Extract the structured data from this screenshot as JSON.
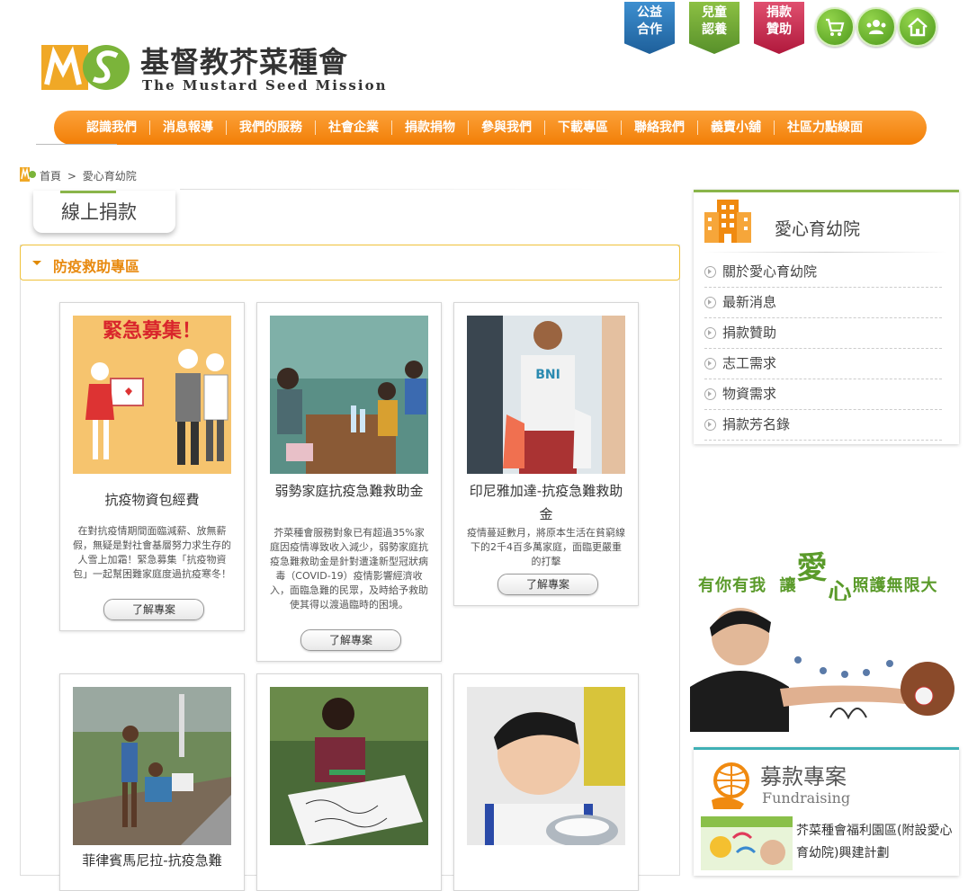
{
  "header": {
    "logo_title_cn": "基督教芥菜種會",
    "logo_title_en": "The Mustard Seed Mission",
    "ribbons": [
      {
        "line1": "公益",
        "line2": "合作",
        "color": "#2a74b5"
      },
      {
        "line1": "兒童",
        "line2": "認養",
        "color": "#6ea33a"
      },
      {
        "line1": "捐款",
        "line2": "贊助",
        "color": "#c9234b"
      }
    ],
    "icon_buttons": [
      "cart-icon",
      "members-icon",
      "home-icon"
    ]
  },
  "nav": {
    "items": [
      "認識我們",
      "消息報導",
      "我們的服務",
      "社會企業",
      "捐款捐物",
      "參與我們",
      "下載專區",
      "聯絡我們",
      "義賣小舖",
      "社區力點線面"
    ],
    "color": "#f5870f"
  },
  "breadcrumb": {
    "home": "首頁",
    "separator": ">",
    "current": "愛心育幼院"
  },
  "main": {
    "tab_label": "線上捐款",
    "section_title": "防疫救助專區",
    "more_label": "了解專案",
    "cards": [
      {
        "title": "抗疫物資包經費",
        "desc": "在對抗疫情期間面臨減薪、放無薪假，無疑是對社會基層努力求生存的人雪上加霜！緊急募集「抗疫物資包」一起幫困難家庭度過抗疫寒冬！",
        "photo_caption": "緊急募集！"
      },
      {
        "title": "弱勢家庭抗疫急難救助金",
        "desc": "芥菜種會服務對象已有超過35%家庭因疫情導致收入減少，弱勢家庭抗疫急難救助金是針對遭逢新型冠狀病毒（COVID-19）疫情影響經濟收入，面臨急難的民眾，及時給予救助使其得以渡過臨時的困境。"
      },
      {
        "title": "印尼雅加達-抗疫急難救助金",
        "desc": "疫情蔓延數月，將原本生活在貧窮線下的2千4百多萬家庭，面臨更嚴重的打擊",
        "photo_caption": "BNI"
      },
      {
        "title": "菲律賓馬尼拉-抗疫急難"
      },
      {
        "title": ""
      },
      {
        "title": ""
      }
    ]
  },
  "sidebar": {
    "title": "愛心育幼院",
    "menu": [
      "關於愛心育幼院",
      "最新消息",
      "捐款贊助",
      "志工需求",
      "物資需求",
      "捐款芳名錄"
    ],
    "slogan_a": "有你有我",
    "slogan_b": "讓",
    "slogan_c": "愛",
    "slogan_d": "心",
    "slogan_e": "照護無限大",
    "fund_title": "募款專案",
    "fund_subtitle": "Fundraising",
    "fund_project": "芥菜種會福利園區(附設愛心育幼院)興建計劃"
  }
}
